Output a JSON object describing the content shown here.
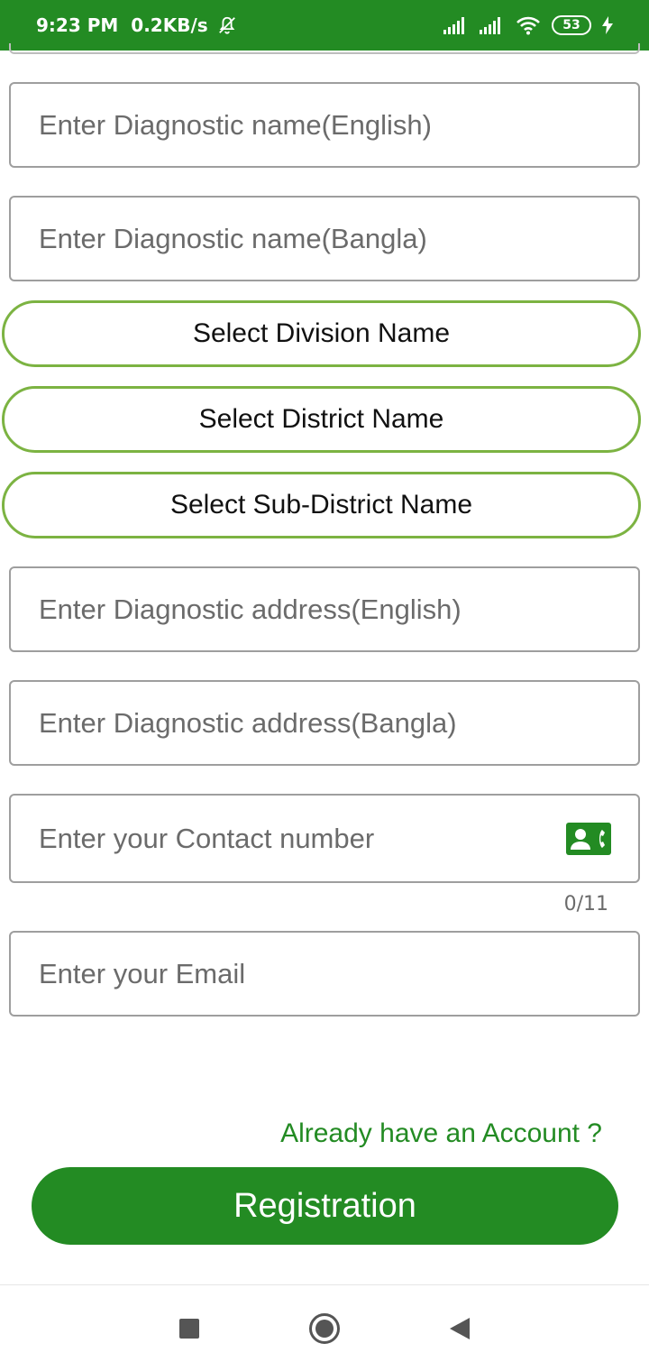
{
  "status_bar": {
    "time": "9:23 PM",
    "speed": "0.2KB/s",
    "battery": "53",
    "icons": [
      "bell-off-icon",
      "signal-icon",
      "signal-icon",
      "wifi-icon",
      "battery-icon",
      "charging-icon"
    ]
  },
  "form": {
    "diag_name_en": {
      "placeholder": "Enter Diagnostic name(English)",
      "value": ""
    },
    "diag_name_bn": {
      "placeholder": "Enter Diagnostic name(Bangla)",
      "value": ""
    },
    "division": "Select Division Name",
    "district": "Select District Name",
    "subdistrict": "Select Sub-District Name",
    "addr_en": {
      "placeholder": "Enter Diagnostic address(English)",
      "value": ""
    },
    "addr_bn": {
      "placeholder": "Enter Diagnostic address(Bangla)",
      "value": ""
    },
    "contact": {
      "placeholder": "Enter your Contact number",
      "value": "",
      "counter": "0/11",
      "icon": "contact-phone-icon"
    },
    "email": {
      "placeholder": "Enter your Email",
      "value": ""
    }
  },
  "login_link": "Already have an Account ?",
  "register_label": "Registration",
  "nav": {
    "icons": [
      "recent-apps-icon",
      "home-icon",
      "back-icon"
    ]
  },
  "colors": {
    "primary": "#238b23",
    "select_border": "#7cb342",
    "field_border": "#9e9e9e"
  }
}
